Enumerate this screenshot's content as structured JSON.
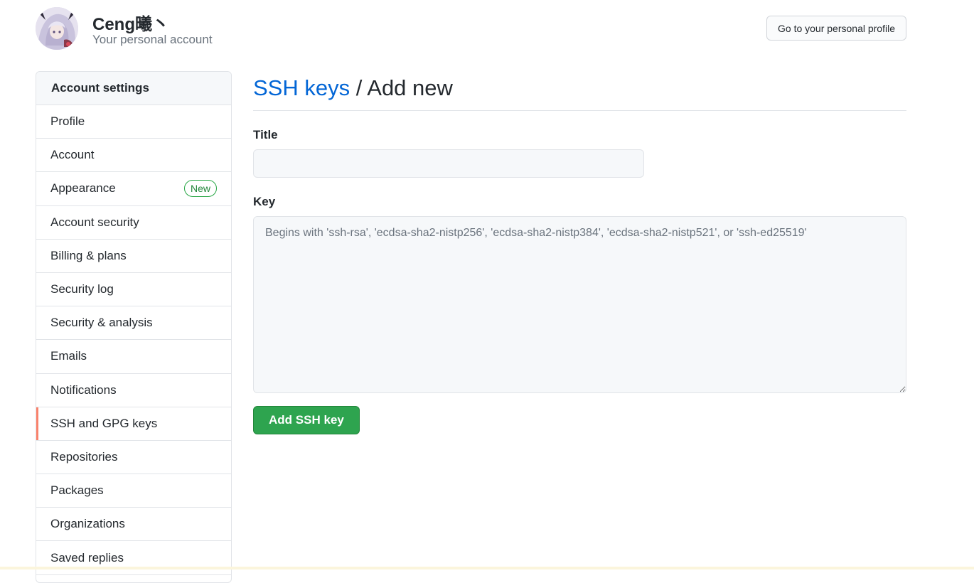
{
  "header": {
    "account_name": "Ceng曦丶",
    "account_subtitle": "Your personal account",
    "profile_button_label": "Go to your personal profile"
  },
  "sidebar": {
    "heading": "Account settings",
    "selected_accent": "#f9826c",
    "items": [
      {
        "label": "Profile"
      },
      {
        "label": "Account"
      },
      {
        "label": "Appearance",
        "badge": "New"
      },
      {
        "label": "Account security"
      },
      {
        "label": "Billing & plans"
      },
      {
        "label": "Security log"
      },
      {
        "label": "Security & analysis"
      },
      {
        "label": "Emails"
      },
      {
        "label": "Notifications"
      },
      {
        "label": "SSH and GPG keys",
        "selected": true
      },
      {
        "label": "Repositories"
      },
      {
        "label": "Packages"
      },
      {
        "label": "Organizations"
      },
      {
        "label": "Saved replies"
      }
    ]
  },
  "main": {
    "breadcrumb_link": "SSH keys",
    "breadcrumb_separator": "/",
    "breadcrumb_current": "Add new",
    "title_label": "Title",
    "title_value": "",
    "key_label": "Key",
    "key_placeholder": "Begins with 'ssh-rsa', 'ecdsa-sha2-nistp256', 'ecdsa-sha2-nistp384', 'ecdsa-sha2-nistp521', or 'ssh-ed25519'",
    "submit_label": "Add SSH key",
    "submit_color": "#2ea44f",
    "link_color": "#0366d6"
  }
}
